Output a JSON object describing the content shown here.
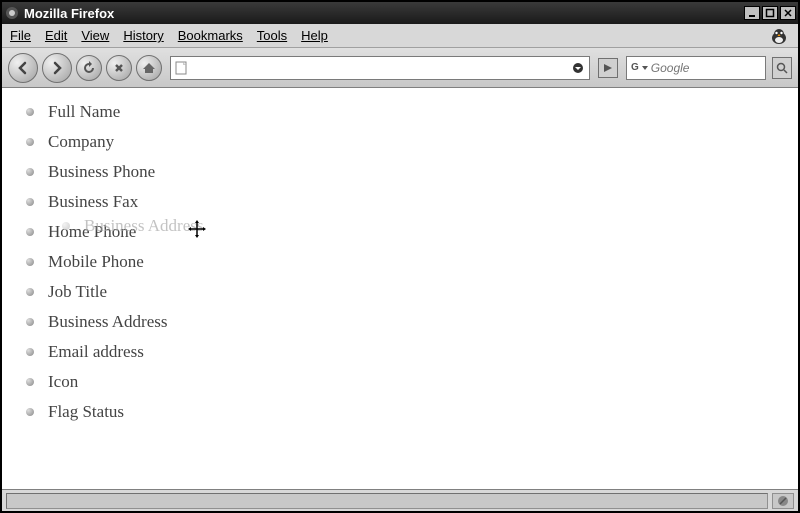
{
  "window": {
    "title": "Mozilla Firefox"
  },
  "menu": {
    "file": "File",
    "edit": "Edit",
    "view": "View",
    "history": "History",
    "bookmarks": "Bookmarks",
    "tools": "Tools",
    "help": "Help"
  },
  "toolbar": {
    "url_value": "",
    "search_placeholder": "Google"
  },
  "list": {
    "items": [
      "Full Name",
      "Company",
      "Business Phone",
      "Business Fax",
      "Home Phone",
      "Mobile Phone",
      "Job Title",
      "Business Address",
      "Email address",
      "Icon",
      "Flag Status"
    ]
  },
  "drag": {
    "ghost_label": "Business Address"
  }
}
